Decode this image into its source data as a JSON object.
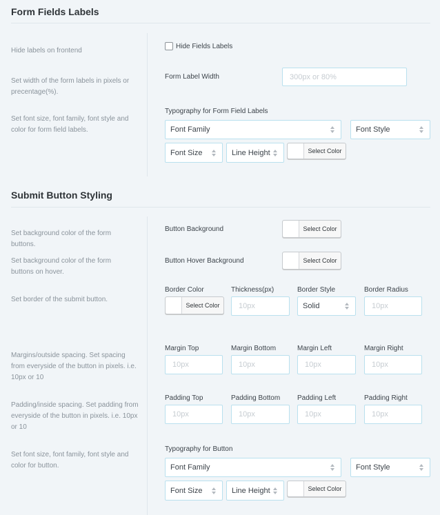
{
  "section1": {
    "title": "Form Fields Labels",
    "hide_desc": "Hide labels on frontend",
    "hide_checkbox_label": "Hide Fields Labels",
    "width_desc": "Set width of the form labels in pixels or precentage(%).",
    "width_label": "Form Label Width",
    "width_placeholder": "300px or 80%",
    "typo_desc": "Set font size, font family, font style and color for form field labels.",
    "typo_label": "Typography for Form Field Labels",
    "font_family": "Font Family",
    "font_style": "Font Style",
    "font_size": "Font Size",
    "line_height": "Line Height",
    "select_color": "Select Color"
  },
  "section2": {
    "title": "Submit Button Styling",
    "bg_desc": "Set background color of the form buttons.",
    "bg_label": "Button Background",
    "bg_color": "Select Color",
    "hover_desc": "Set background color of the form buttons on hover.",
    "hover_label": "Button Hover Background",
    "hover_color": "Select Color",
    "border_desc": "Set border of the submit button.",
    "border_labels": [
      "Border Color",
      "Thickness(px)",
      "Border Style",
      "Border Radius"
    ],
    "border_color": "Select Color",
    "thickness_placeholder": "10px",
    "border_style_value": "Solid",
    "radius_placeholder": "10px",
    "margin_desc": "Margins/outside spacing. Set spacing from everyside of the button in pixels. i.e. 10px or 10",
    "margin_labels": [
      "Margin Top",
      "Margin Bottom",
      "Margin Left",
      "Margin Right"
    ],
    "margin_placeholders": [
      "10px",
      "10px",
      "10px",
      "10px"
    ],
    "padding_desc": "Padding/inside spacing. Set padding from everyside of the button in pixels. i.e. 10px or 10",
    "padding_labels": [
      "Padding Top",
      "Padding Bottom",
      "Padding Left",
      "Padding Right"
    ],
    "padding_placeholders": [
      "10px",
      "10px",
      "10px",
      "10px"
    ],
    "typo_desc": "Set font size, font family, font style and color for button.",
    "typo_label": "Typography for Button",
    "font_family": "Font Family",
    "font_style": "Font Style",
    "font_size": "Font Size",
    "line_height": "Line Height",
    "select_color": "Select Color"
  }
}
